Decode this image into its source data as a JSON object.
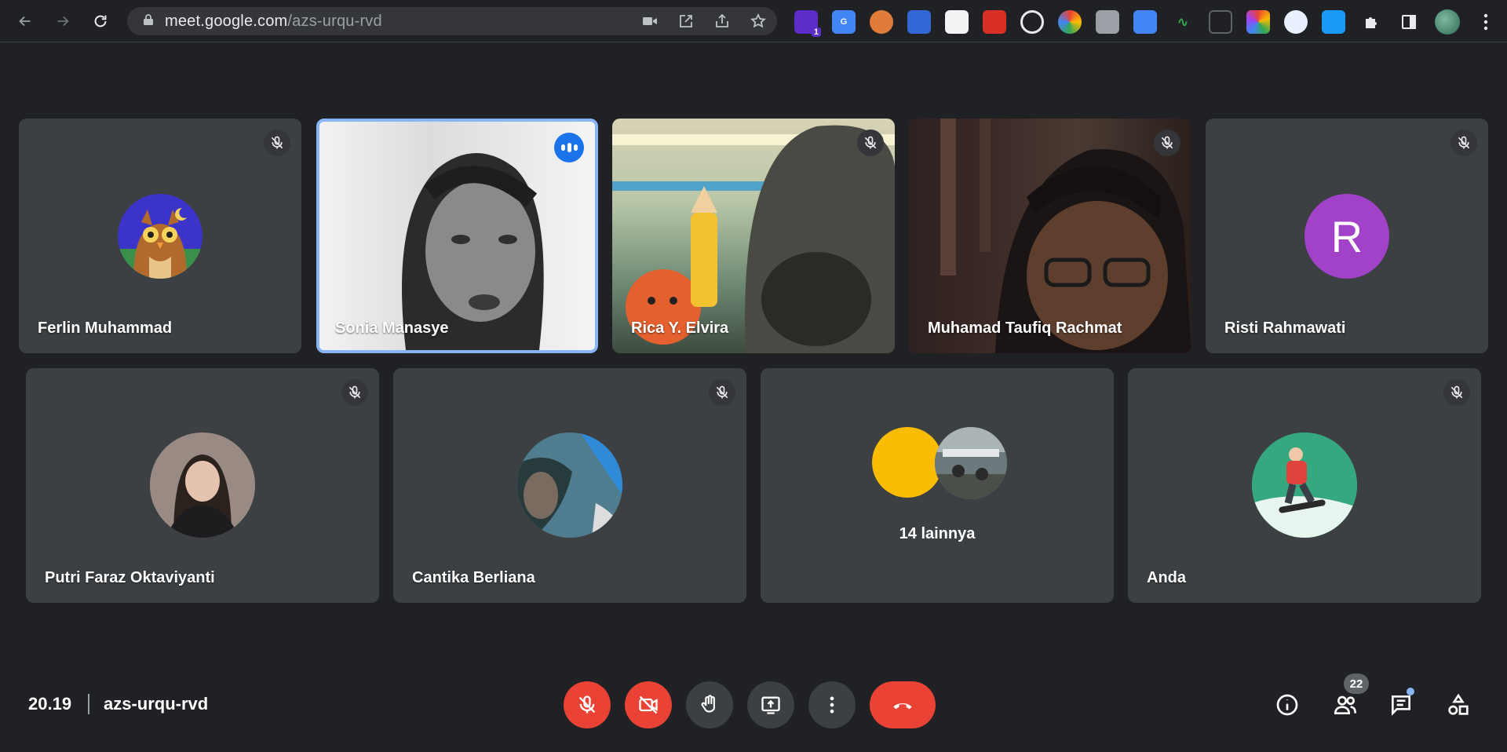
{
  "browser": {
    "url_host": "meet.google.com",
    "url_path": "/azs-urqu-rvd",
    "extension_badge": "1"
  },
  "tiles_row1": [
    {
      "name": "Ferlin Muhammad"
    },
    {
      "name": "Sonia Manasye"
    },
    {
      "name": "Rica Y. Elvira"
    },
    {
      "name": "Muhamad Taufiq Rachmat"
    },
    {
      "name": "Risti Rahmawati",
      "initial": "R",
      "avatar_color": "#a142c9"
    }
  ],
  "tiles_row2": [
    {
      "name": "Putri Faraz Oktaviyanti"
    },
    {
      "name": "Cantika Berliana"
    },
    {
      "others_label": "14 lainnya"
    },
    {
      "name": "Anda"
    }
  ],
  "bottom": {
    "time": "20.19",
    "meeting_code": "azs-urqu-rvd",
    "participant_count": "22"
  },
  "colors": {
    "accent": "#1a73e8",
    "danger": "#ea4335",
    "tile": "#3c4043"
  }
}
